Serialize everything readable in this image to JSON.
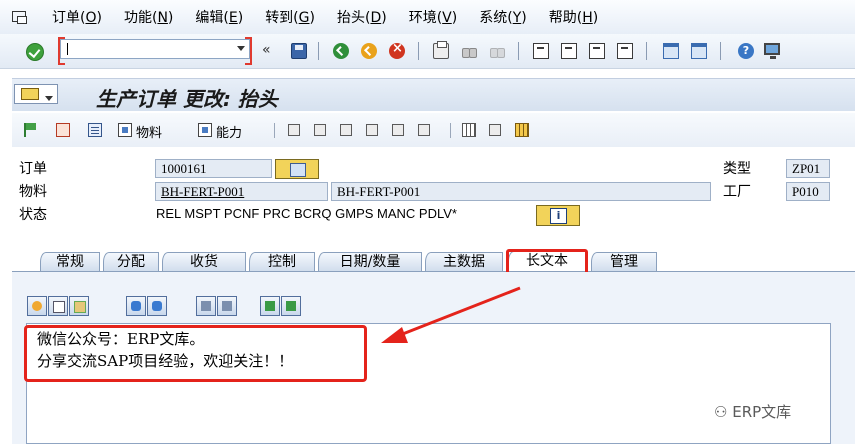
{
  "menu": {
    "items": [
      {
        "label": "订单(",
        "key": "O",
        "end": ")"
      },
      {
        "label": "功能(",
        "key": "N",
        "end": ")"
      },
      {
        "label": "编辑(",
        "key": "E",
        "end": ")"
      },
      {
        "label": "转到(",
        "key": "G",
        "end": ")"
      },
      {
        "label": "抬头(",
        "key": "D",
        "end": ")"
      },
      {
        "label": "环境(",
        "key": "V",
        "end": ")"
      },
      {
        "label": "系统(",
        "key": "Y",
        "end": ")"
      },
      {
        "label": "帮助(",
        "key": "H",
        "end": ")"
      }
    ]
  },
  "toolbar": {
    "command_value": "",
    "chevron": "«",
    "help_glyph": "?"
  },
  "title": {
    "text": "生产订单 更改: 抬头"
  },
  "app_toolbar": {
    "material_label": "物料",
    "capacity_label": "能力"
  },
  "header": {
    "order_label": "订单",
    "order_value": "1000161",
    "material_label": "物料",
    "material_value": "BH-FERT-P001",
    "material_desc": "BH-FERT-P001",
    "status_label": "状态",
    "status_value": "REL  MSPT PCNF PRC  BCRQ GMPS MANC PDLV*",
    "type_label": "类型",
    "type_value": "ZP01",
    "plant_label": "工厂",
    "plant_value": "P010",
    "info_glyph": "i"
  },
  "tabs": [
    {
      "label": "常规",
      "active": false
    },
    {
      "label": "分配",
      "active": false
    },
    {
      "label": "收货",
      "active": false
    },
    {
      "label": "控制",
      "active": false
    },
    {
      "label": "日期/数量",
      "active": false
    },
    {
      "label": "主数据",
      "active": false
    },
    {
      "label": "长文本",
      "active": true
    },
    {
      "label": "管理",
      "active": false
    }
  ],
  "long_text": {
    "line1": "微信公众号：ERP文库。",
    "line2": "分享交流SAP项目经验，欢迎关注！！"
  },
  "watermark": {
    "text": "ERP文库"
  },
  "colors": {
    "highlight": "#e4231b",
    "field_bg": "#e4ebf4",
    "button_yellow": "#f2d35a"
  }
}
